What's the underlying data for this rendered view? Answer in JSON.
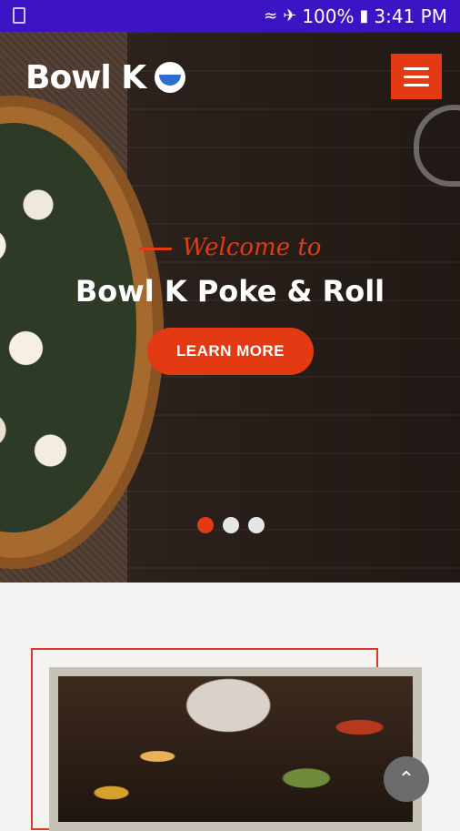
{
  "status_bar": {
    "battery_text": "100%",
    "time": "3:41 PM",
    "icons": [
      "sim-icon",
      "wifi-icon",
      "airplane-icon",
      "battery-icon"
    ]
  },
  "header": {
    "brand": "Bowl K",
    "menu_icon": "hamburger-icon"
  },
  "hero": {
    "welcome": "Welcome to",
    "title": "Bowl K Poke & Roll",
    "cta_label": "LEARN MORE",
    "slides_total": 3,
    "active_slide": 1
  },
  "colors": {
    "accent": "#e33a13",
    "status_bar": "#3d14c4",
    "scroll_button": "#6c6c6c"
  },
  "scroll_top_icon": "chevron-up-icon"
}
